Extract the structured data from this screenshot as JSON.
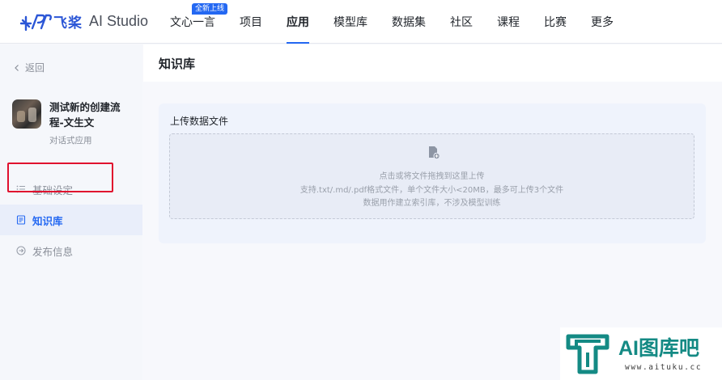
{
  "header": {
    "logo_cn": "飞桨",
    "logo_en": "AI Studio",
    "nav": [
      {
        "label": "文心一言",
        "badge": "全新上线"
      },
      {
        "label": "项目"
      },
      {
        "label": "应用",
        "active": true
      },
      {
        "label": "模型库"
      },
      {
        "label": "数据集"
      },
      {
        "label": "社区"
      },
      {
        "label": "课程"
      },
      {
        "label": "比赛"
      },
      {
        "label": "更多"
      }
    ]
  },
  "sidebar": {
    "back_label": "返回",
    "app": {
      "name": "测试新的创建流程-文生文",
      "type": "对话式应用"
    },
    "menu": [
      {
        "label": "基础设定",
        "icon": "list-icon"
      },
      {
        "label": "知识库",
        "icon": "document-icon",
        "active": true
      },
      {
        "label": "发布信息",
        "icon": "arrow-circle-icon"
      }
    ]
  },
  "main": {
    "title": "知识库",
    "upload": {
      "label": "上传数据文件",
      "hint_line1": "点击或将文件拖拽到这里上传",
      "hint_line2": "支持.txt/.md/.pdf格式文件，单个文件大小<20MB，最多可上传3个文件",
      "hint_line3": "数据用作建立索引库，不涉及模型训练"
    }
  },
  "watermark": {
    "title": "AI图库吧",
    "url": "www.aituku.cc"
  },
  "colors": {
    "accent": "#2468f2",
    "highlight_border": "#e0102e",
    "watermark": "#148a84"
  }
}
